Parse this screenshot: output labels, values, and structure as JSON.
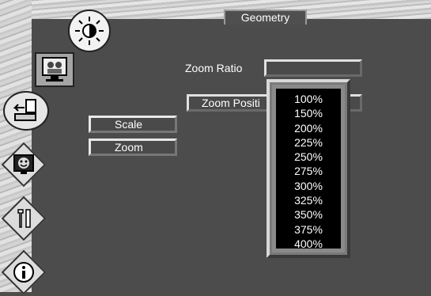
{
  "title": "Geometry",
  "sidebar": {
    "items": [
      {
        "name": "brightness-icon"
      },
      {
        "name": "picture-icon"
      },
      {
        "name": "input-source-icon"
      },
      {
        "name": "display-face-icon"
      },
      {
        "name": "tools-icon"
      },
      {
        "name": "info-icon"
      }
    ]
  },
  "main": {
    "zoom_ratio_label": "Zoom Ratio",
    "zoom_ratio_value": "",
    "zoom_position_label": "Zoom Positi",
    "scale_label": "Scale",
    "zoom_label": "Zoom"
  },
  "dropdown": {
    "options": [
      "100%",
      "150%",
      "200%",
      "225%",
      "250%",
      "275%",
      "300%",
      "325%",
      "350%",
      "375%",
      "400%"
    ]
  }
}
